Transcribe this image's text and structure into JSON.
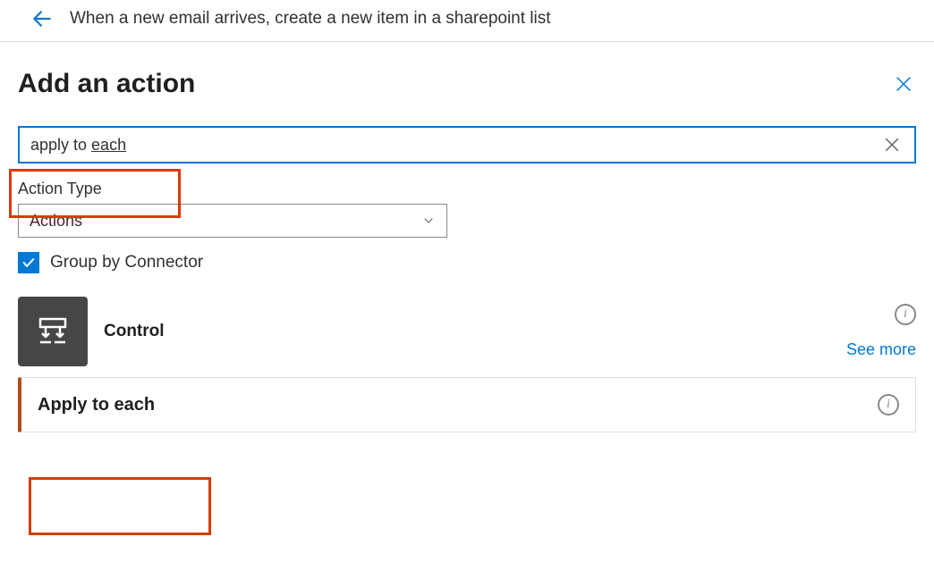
{
  "header": {
    "flow_title": "When a new email arrives, create a new item in a sharepoint list"
  },
  "panel": {
    "title": "Add an action",
    "search_value_pre": "apply to ",
    "search_value_underlined": "each",
    "action_type_label": "Action Type",
    "action_type_value": "Actions",
    "group_by_label": "Group by Connector"
  },
  "results": {
    "connector_name": "Control",
    "see_more": "See more",
    "action_name": "Apply to each"
  }
}
